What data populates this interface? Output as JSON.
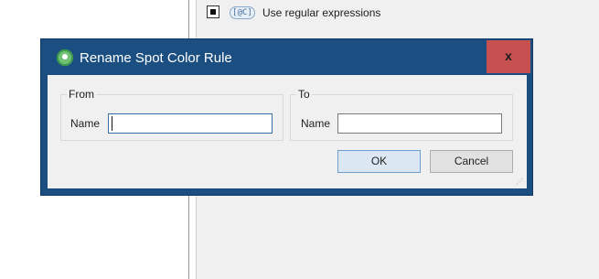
{
  "background": {
    "regex_checkbox_checked": true,
    "regex_badge": "[@C]",
    "regex_label": "Use regular expressions"
  },
  "dialog": {
    "title": "Rename Spot Color Rule",
    "close_label": "x",
    "from_group": {
      "title": "From",
      "name_label": "Name",
      "name_value": ""
    },
    "to_group": {
      "title": "To",
      "name_label": "Name",
      "name_value": ""
    },
    "ok_label": "OK",
    "cancel_label": "Cancel"
  },
  "colors": {
    "titlebar": "#1b4f82",
    "close_button": "#c75050",
    "client_bg": "#f0f0f0",
    "app_icon": "#6fc276"
  }
}
